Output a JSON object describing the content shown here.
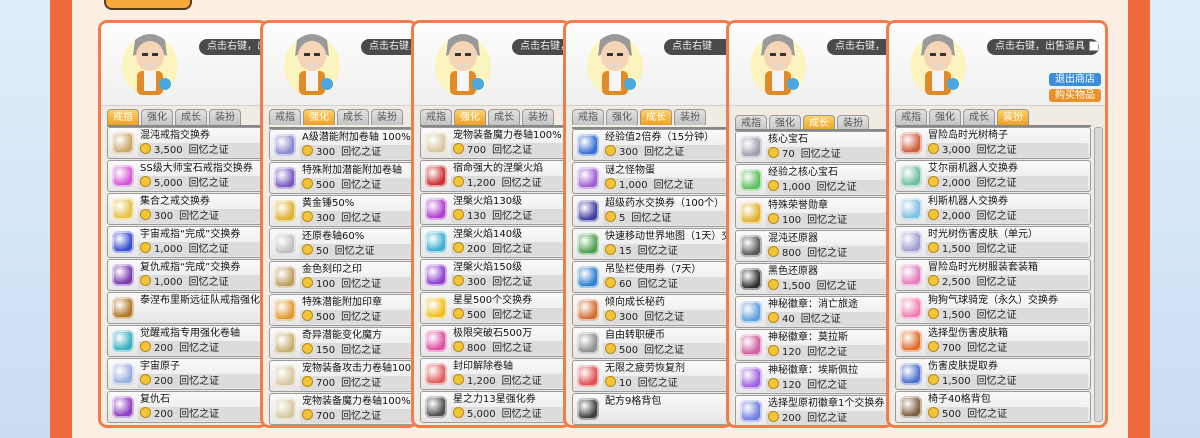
{
  "price_unit": "回忆之证",
  "colors": {
    "frame": "#f27c4a",
    "side_bar": "#ef6a3c",
    "tab_active": "#f0a020",
    "coin": "#f4c438"
  },
  "panels": [
    {
      "bubble": "点击右键，出",
      "tabs": [
        "戒指",
        "强化",
        "成长",
        "装扮"
      ],
      "active_tab": 0,
      "items": [
        {
          "name": "混沌戒指交换券",
          "price": "3,500",
          "icon": "scroll-icon",
          "color": "#c9a96a"
        },
        {
          "name": "SS级大师宝石戒指交换券",
          "price": "5,000",
          "icon": "ring-icon",
          "color": "#d45ad4"
        },
        {
          "name": "集合之戒交换券",
          "price": "300",
          "icon": "ring-icon",
          "color": "#e6c34a"
        },
        {
          "name": "宇宙戒指“完成”交换券",
          "price": "1,000",
          "icon": "ring-icon",
          "color": "#3a4fd0"
        },
        {
          "name": "复仇戒指“完成”交换券",
          "price": "1,000",
          "icon": "ring-icon",
          "color": "#7a3ab0"
        },
        {
          "name": "泰涅布里斯远征队戒指强化",
          "price": "",
          "icon": "scroll-icon",
          "color": "#b0782a"
        },
        {
          "name": "觉醒戒指专用强化卷轴",
          "price": "200",
          "icon": "scroll-icon",
          "color": "#3ab0c0"
        },
        {
          "name": "宇宙原子",
          "price": "200",
          "icon": "atom-icon",
          "color": "#9ab0e0"
        },
        {
          "name": "复仇石",
          "price": "200",
          "icon": "gem-icon",
          "color": "#9040c0"
        }
      ]
    },
    {
      "bubble": "点击右键，出",
      "tabs": [
        "戒指",
        "强化",
        "成长",
        "装扮"
      ],
      "active_tab": 1,
      "items": [
        {
          "name": "A级潜能附加卷轴 100%",
          "price": "300",
          "icon": "scroll-icon",
          "color": "#8a8ad0"
        },
        {
          "name": "特殊附加潜能附加卷轴",
          "price": "500",
          "icon": "scroll-icon",
          "color": "#7a5ac0"
        },
        {
          "name": "黄金锤50%",
          "price": "300",
          "icon": "hammer-icon",
          "color": "#e0b030"
        },
        {
          "name": "还原卷轴60%",
          "price": "50",
          "icon": "scroll-icon",
          "color": "#c0c0c0"
        },
        {
          "name": "金色刻印之印",
          "price": "100",
          "icon": "stamp-icon",
          "color": "#c0a060"
        },
        {
          "name": "特殊潜能附加印章",
          "price": "500",
          "icon": "stamp-icon",
          "color": "#e09a30"
        },
        {
          "name": "奇异潜能变化魔方",
          "price": "150",
          "icon": "cube-icon",
          "color": "#c8b070"
        },
        {
          "name": "宠物装备攻击力卷轴100",
          "price": "700",
          "icon": "scroll-icon",
          "color": "#d8c8a0"
        },
        {
          "name": "宠物装备魔力卷轴100%",
          "price": "700",
          "icon": "scroll-icon",
          "color": "#d8c8a0"
        }
      ]
    },
    {
      "bubble": "点击右键，",
      "tabs": [
        "戒指",
        "强化",
        "成长",
        "装扮"
      ],
      "active_tab": 1,
      "items": [
        {
          "name": "宠物装备魔力卷轴100%",
          "price": "700",
          "icon": "scroll-icon",
          "color": "#d8c8a0"
        },
        {
          "name": "宿命强大的涅槃火焰",
          "price": "1,200",
          "icon": "flame-icon",
          "color": "#d03030"
        },
        {
          "name": "涅槃火焰130级",
          "price": "130",
          "icon": "flame-icon",
          "color": "#b040d0"
        },
        {
          "name": "涅槃火焰140级",
          "price": "200",
          "icon": "flame-icon",
          "color": "#40b0d0"
        },
        {
          "name": "涅槃火焰150级",
          "price": "300",
          "icon": "flame-icon",
          "color": "#9040d0"
        },
        {
          "name": "星星500个交换券",
          "price": "500",
          "icon": "star-icon",
          "color": "#f0c020"
        },
        {
          "name": "极限突破石500万",
          "price": "800",
          "icon": "crystal-icon",
          "color": "#e050a0"
        },
        {
          "name": "封印解除卷轴",
          "price": "1,200",
          "icon": "scroll-icon",
          "color": "#e06060"
        },
        {
          "name": "星之力13星强化券",
          "price": "5,000",
          "icon": "ticket-icon",
          "color": "#505050"
        }
      ]
    },
    {
      "bubble": "点击右键",
      "tabs": [
        "戒指",
        "强化",
        "成长",
        "装扮"
      ],
      "active_tab": 2,
      "items": [
        {
          "name": "经验值2倍券（15分钟）",
          "price": "300",
          "icon": "exp-icon",
          "color": "#3a70d0"
        },
        {
          "name": "谜之怪物蛋",
          "price": "1,000",
          "icon": "egg-icon",
          "color": "#a060d0"
        },
        {
          "name": "超级药水交换券（100个）",
          "price": "5",
          "icon": "potion-icon",
          "color": "#4040a0"
        },
        {
          "name": "快速移动世界地图（1天）交",
          "price": "15",
          "icon": "map-icon",
          "color": "#50a050"
        },
        {
          "name": "吊坠栏使用券（7天）",
          "price": "60",
          "icon": "ticket-icon",
          "color": "#3080d0"
        },
        {
          "name": "倾向成长秘药",
          "price": "300",
          "icon": "potion-icon",
          "color": "#d07030"
        },
        {
          "name": "自由转职硬币",
          "price": "500",
          "icon": "coin-icon",
          "color": "#909090"
        },
        {
          "name": "无限之疲劳恢复剂",
          "price": "10",
          "icon": "potion-icon",
          "color": "#e05050"
        },
        {
          "name": "配方9格背包",
          "price": "",
          "icon": "bag-icon",
          "color": "#404040"
        }
      ]
    },
    {
      "bubble": "点击右键，出",
      "tabs": [
        "戒指",
        "强化",
        "成长",
        "装扮"
      ],
      "active_tab": 2,
      "items": [
        {
          "name": "核心宝石",
          "price": "70",
          "icon": "gem-icon",
          "color": "#a0a0b0"
        },
        {
          "name": "经验之核心宝石",
          "price": "1,000",
          "icon": "gem-icon",
          "color": "#60c060"
        },
        {
          "name": "特殊荣誉勋章",
          "price": "100",
          "icon": "medal-icon",
          "color": "#e0b030"
        },
        {
          "name": "混沌还原器",
          "price": "800",
          "icon": "orb-icon",
          "color": "#5a5a5a"
        },
        {
          "name": "黑色还原器",
          "price": "1,500",
          "icon": "orb-icon",
          "color": "#303030"
        },
        {
          "name": "神秘徽章：消亡旅途",
          "price": "40",
          "icon": "badge-icon",
          "color": "#60a0e0"
        },
        {
          "name": "神秘徽章：莫拉斯",
          "price": "120",
          "icon": "badge-icon",
          "color": "#d060a0"
        },
        {
          "name": "神秘徽章：埃斯佩拉",
          "price": "120",
          "icon": "badge-icon",
          "color": "#a060e0"
        },
        {
          "name": "选择型原初徽章1个交换券",
          "price": "200",
          "icon": "badge-icon",
          "color": "#7080e0"
        }
      ]
    },
    {
      "bubble": "点击右键，出售道具",
      "buttons": {
        "exit": "退出商店",
        "buy": "购买物品"
      },
      "tabs": [
        "戒指",
        "强化",
        "成长",
        "装扮"
      ],
      "active_tab": 3,
      "items": [
        {
          "name": "冒险岛时光树椅子",
          "price": "3,000",
          "icon": "tree-icon",
          "color": "#d06040"
        },
        {
          "name": "艾尔丽机器人交换券",
          "price": "2,000",
          "icon": "robot-icon",
          "color": "#70c0a0"
        },
        {
          "name": "利斯机器人交换券",
          "price": "2,000",
          "icon": "robot-icon",
          "color": "#80c0e0"
        },
        {
          "name": "时光树伤害皮肤（单元）",
          "price": "1,500",
          "icon": "skin-icon",
          "color": "#a0a0d0"
        },
        {
          "name": "冒险岛时光树服装套装箱",
          "price": "2,500",
          "icon": "box-icon",
          "color": "#e080c0"
        },
        {
          "name": "狗狗气球骑宠（永久）交换券",
          "price": "1,500",
          "icon": "balloon-icon",
          "color": "#f080b0"
        },
        {
          "name": "选择型伤害皮肤箱",
          "price": "700",
          "icon": "box-icon",
          "color": "#e07030"
        },
        {
          "name": "伤害皮肤提取券",
          "price": "1,500",
          "icon": "ticket-icon",
          "color": "#5070d0"
        },
        {
          "name": "椅子40格背包",
          "price": "500",
          "icon": "bag-icon",
          "color": "#806040"
        }
      ]
    }
  ]
}
